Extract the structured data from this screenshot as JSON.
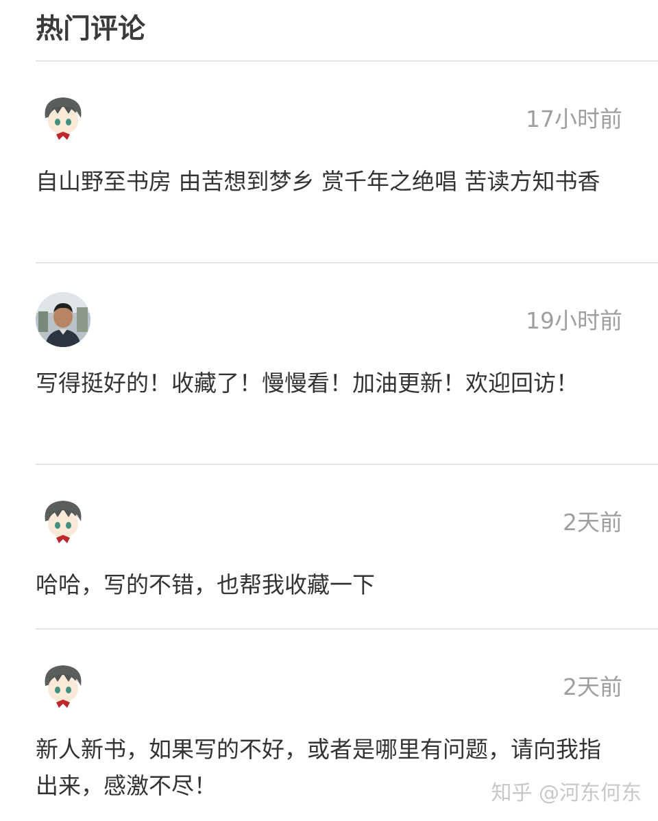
{
  "section": {
    "title": "热门评论"
  },
  "comments": [
    {
      "avatar": "anime-boy-avatar-icon",
      "time": "17小时前",
      "text": "自山野至书房 由苦想到梦乡 赏千年之绝唱 苦读方知书香"
    },
    {
      "avatar": "photo-avatar-icon",
      "time": "19小时前",
      "text": "写得挺好的！收藏了！慢慢看！加油更新！欢迎回访！"
    },
    {
      "avatar": "anime-boy-avatar-icon",
      "time": "2天前",
      "text": "哈哈，写的不错，也帮我收藏一下"
    },
    {
      "avatar": "anime-boy-avatar-icon",
      "time": "2天前",
      "text": "新人新书，如果写的不好，或者是哪里有问题，请向我指出来，感激不尽！"
    }
  ],
  "watermark": "知乎 @河东何东"
}
